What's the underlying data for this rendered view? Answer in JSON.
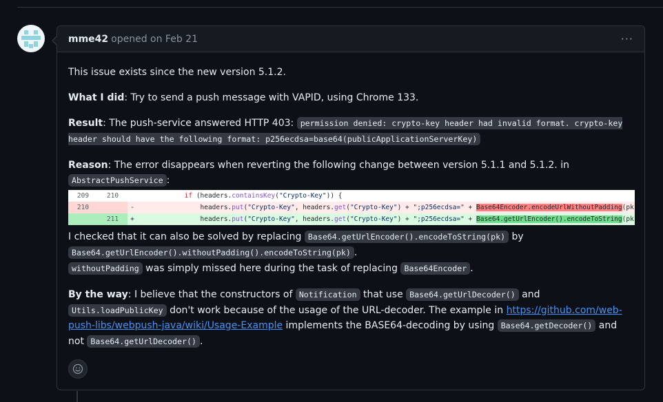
{
  "comment": {
    "author": "mme42",
    "meta": "opened on Feb 21",
    "menu_icon": "kebab-horizontal-icon",
    "p1": "This issue exists since the new version 5.1.2.",
    "p2_label": "What I did",
    "p2_text": ": Try to send a push message with VAPID, using Chrome 133.",
    "p3_label": "Result",
    "p3_text": ": The push-service answered HTTP 403: ",
    "p3_code": "permission denied: crypto-key header had invalid format. crypto-key header should have the following format: p256ecdsa=base64(publicApplicationServerKey)",
    "p4_label": "Reason",
    "p4_text": ": The error disappears when reverting the following change between version 5.1.1 and 5.1.2. in ",
    "p4_code": "AbstractPushService",
    "p4_colon": ":",
    "p5_t1": "I checked that it can also be solved by replacing ",
    "p5_c1": "Base64.getUrlEncoder().encodeToString(pk)",
    "p5_t2": " by ",
    "p5_c2": "Base64.getUrlEncoder().withoutPadding().encodeToString(pk)",
    "p5_t3": ".",
    "p5_c3": "withoutPadding",
    "p5_t4": " was simply missed here during the task of replacing ",
    "p5_c4": "Base64Encoder",
    "p5_t5": ".",
    "p6_label": "By the way",
    "p6_t1": ": I believe that the constructors of ",
    "p6_c1": "Notification",
    "p6_t2": " that use ",
    "p6_c2": "Base64.getUrlDecoder()",
    "p6_t3": " and ",
    "p6_c3": "Utils.loadPublicKey",
    "p6_t4": " don't work because of the usage of the URL-decoder. The example in ",
    "p6_link": "https://github.com/web-push-libs/webpush-java/wiki/Usage-Example",
    "p6_t5": " implements the BASE64-decoding by using ",
    "p6_c4": "Base64.getDecoder()",
    "p6_t6": " and not ",
    "p6_c5": "Base64.getUrlDecoder()",
    "p6_t7": ".",
    "emoji_icon": "smiley-icon"
  },
  "diff": {
    "row1": {
      "n1": "209",
      "n2": "210",
      "sign": "",
      "indent": "            ",
      "kw": "if",
      "a": " (headers.",
      "fn": "containsKey",
      "b": "(",
      "str": "\"Crypto-Key\"",
      "c": ")) {"
    },
    "row2": {
      "n1": "210",
      "n2": "",
      "sign": "-",
      "indent": "                ",
      "a": "headers.",
      "fn1": "put",
      "b": "(",
      "s1": "\"Crypto-Key\"",
      "c": ", headers.",
      "fn2": "get",
      "d": "(",
      "s2": "\"Crypto-Key\"",
      "e": ") + ",
      "s3": "\";p256ecdsa=\"",
      "f": " + ",
      "hl": "Base64Encoder.encodeUrlWithoutPadding",
      "g": "(pk));"
    },
    "row3": {
      "n1": "",
      "n2": "211",
      "sign": "+",
      "indent": "                ",
      "a": "headers.",
      "fn1": "put",
      "b": "(",
      "s1": "\"Crypto-Key\"",
      "c": ", headers.",
      "fn2": "get",
      "d": "(",
      "s2": "\"Crypto-Key\"",
      "e": ") + ",
      "s3": "\";p256ecdsa=\"",
      "f": " + ",
      "hl": "Base64.getUrlEncoder().encodeToString",
      "g": "(pk));"
    }
  }
}
